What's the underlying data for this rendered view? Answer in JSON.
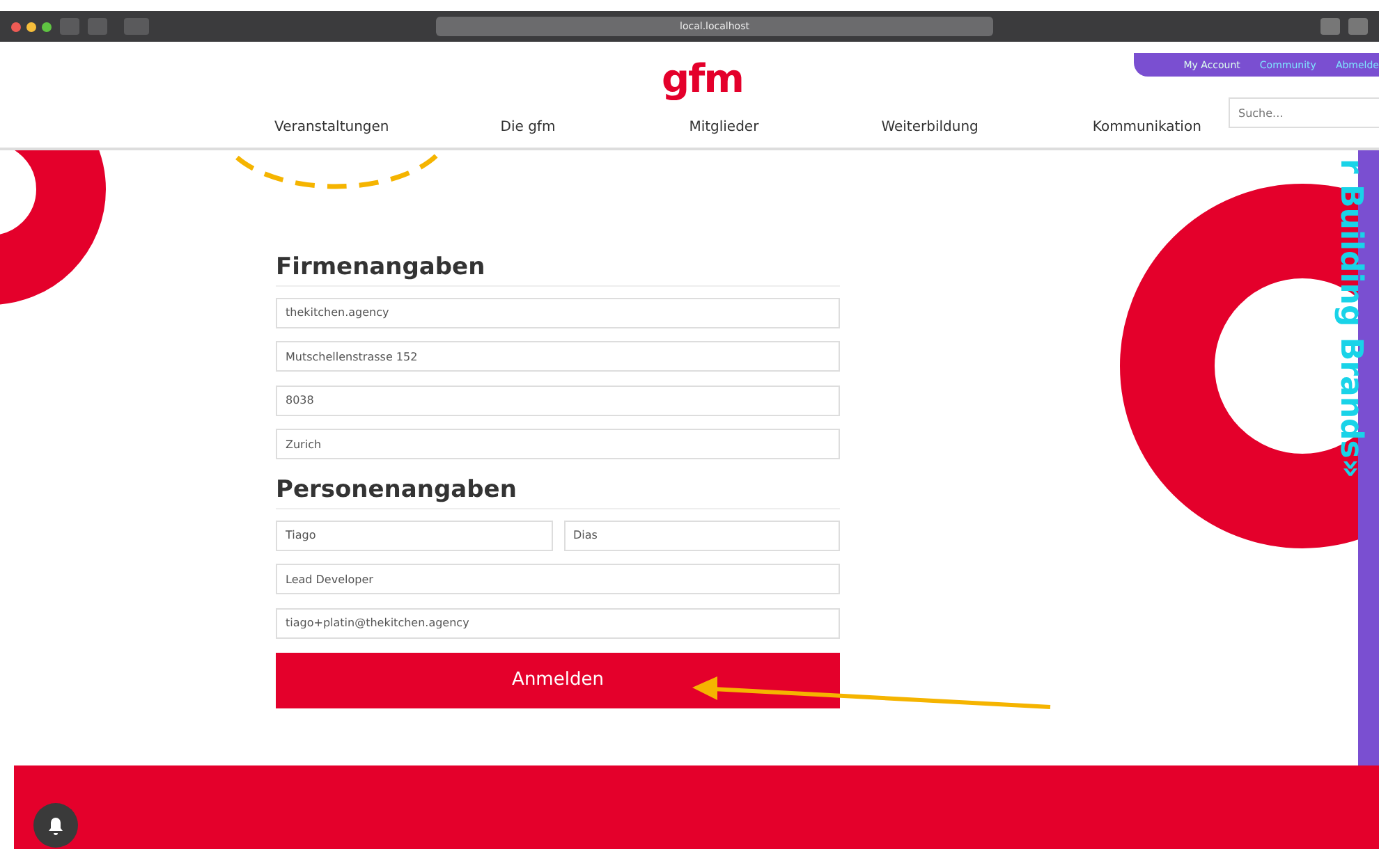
{
  "browser": {
    "address": "local.localhost"
  },
  "header": {
    "logo": "gfm",
    "account_links": [
      "My Account",
      "Community",
      "Abmelde"
    ],
    "search": {
      "placeholder": "Suche..."
    },
    "nav": [
      "Veranstaltungen",
      "Die gfm",
      "Mitglieder",
      "Weiterbildung",
      "Kommunikation"
    ]
  },
  "side_banner": "r Building Brands»",
  "form": {
    "sections": [
      {
        "title": "Firmenangaben",
        "rows": [
          [
            "thekitchen.agency"
          ],
          [
            "Mutschellenstrasse 152"
          ],
          [
            "8038"
          ],
          [
            "Zurich"
          ]
        ]
      },
      {
        "title": "Personenangaben",
        "rows": [
          [
            "Tiago",
            "Dias"
          ],
          [
            "Lead Developer"
          ],
          [
            "tiago+platin@thekitchen.agency"
          ]
        ]
      }
    ],
    "submit": "Anmelden"
  }
}
